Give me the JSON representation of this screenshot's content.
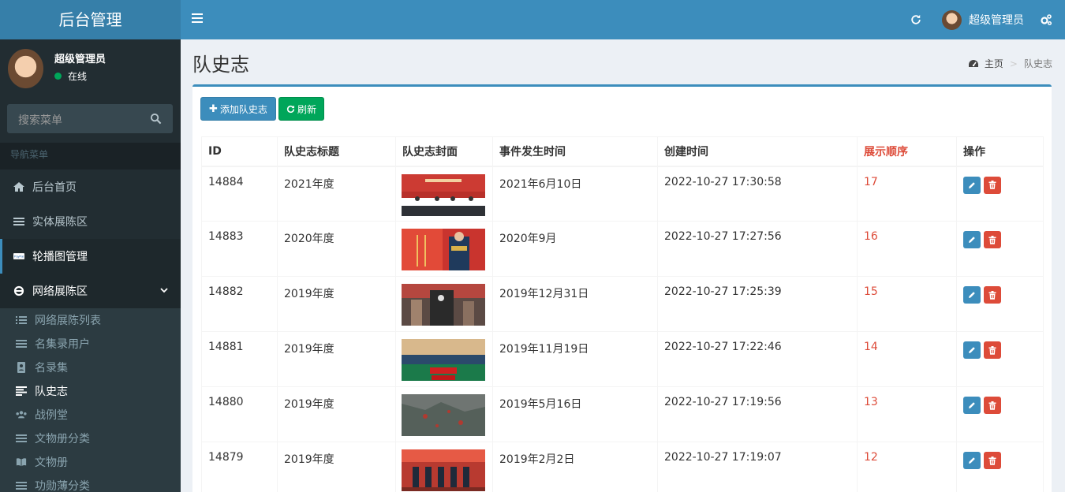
{
  "app": {
    "logo": "后台管理"
  },
  "topbar": {
    "user_name": "超级管理员"
  },
  "sidebar": {
    "user_name": "超级管理员",
    "status": "在线",
    "search_placeholder": "搜索菜单",
    "nav_header": "导航菜单",
    "items": [
      {
        "label": "后台首页",
        "icon": "home-icon"
      },
      {
        "label": "实体展陈区",
        "icon": "list-icon"
      },
      {
        "label": "轮播图管理",
        "icon": "paypal-icon"
      },
      {
        "label": "网络展陈区",
        "icon": "internet-explorer-icon"
      }
    ],
    "subitems": [
      {
        "label": "网络展陈列表",
        "icon": "ordered-list-icon"
      },
      {
        "label": "名集录用户",
        "icon": "list-icon"
      },
      {
        "label": "名录集",
        "icon": "address-book-icon"
      },
      {
        "label": "队史志",
        "icon": "align-left-icon"
      },
      {
        "label": "战例堂",
        "icon": "users-icon"
      },
      {
        "label": "文物册分类",
        "icon": "list-icon"
      },
      {
        "label": "文物册",
        "icon": "book-icon"
      },
      {
        "label": "功勋薄分类",
        "icon": "list-icon"
      }
    ]
  },
  "content": {
    "title": "队史志",
    "breadcrumb": {
      "home": "主页",
      "current": "队史志"
    },
    "toolbar": {
      "add_label": "添加队史志",
      "refresh_label": "刷新"
    },
    "table": {
      "headers": [
        "ID",
        "队史志标题",
        "队史志封面",
        "事件发生时间",
        "创建时间",
        "展示顺序",
        "操作"
      ],
      "rows": [
        {
          "id": "14884",
          "title": "2021年度",
          "event_time": "2021年6月10日",
          "created": "2022-10-27 17:30:58",
          "order": "17"
        },
        {
          "id": "14883",
          "title": "2020年度",
          "event_time": "2020年9月",
          "created": "2022-10-27 17:27:56",
          "order": "16"
        },
        {
          "id": "14882",
          "title": "2019年度",
          "event_time": "2019年12月31日",
          "created": "2022-10-27 17:25:39",
          "order": "15"
        },
        {
          "id": "14881",
          "title": "2019年度",
          "event_time": "2019年11月19日",
          "created": "2022-10-27 17:22:46",
          "order": "14"
        },
        {
          "id": "14880",
          "title": "2019年度",
          "event_time": "2019年5月16日",
          "created": "2022-10-27 17:19:56",
          "order": "13"
        },
        {
          "id": "14879",
          "title": "2019年度",
          "event_time": "2019年2月2日",
          "created": "2022-10-27 17:19:07",
          "order": "12"
        }
      ]
    }
  },
  "colors": {
    "primary": "#3c8dbc",
    "danger": "#dd4b39",
    "success": "#00a65a",
    "sidebar": "#222d32"
  }
}
